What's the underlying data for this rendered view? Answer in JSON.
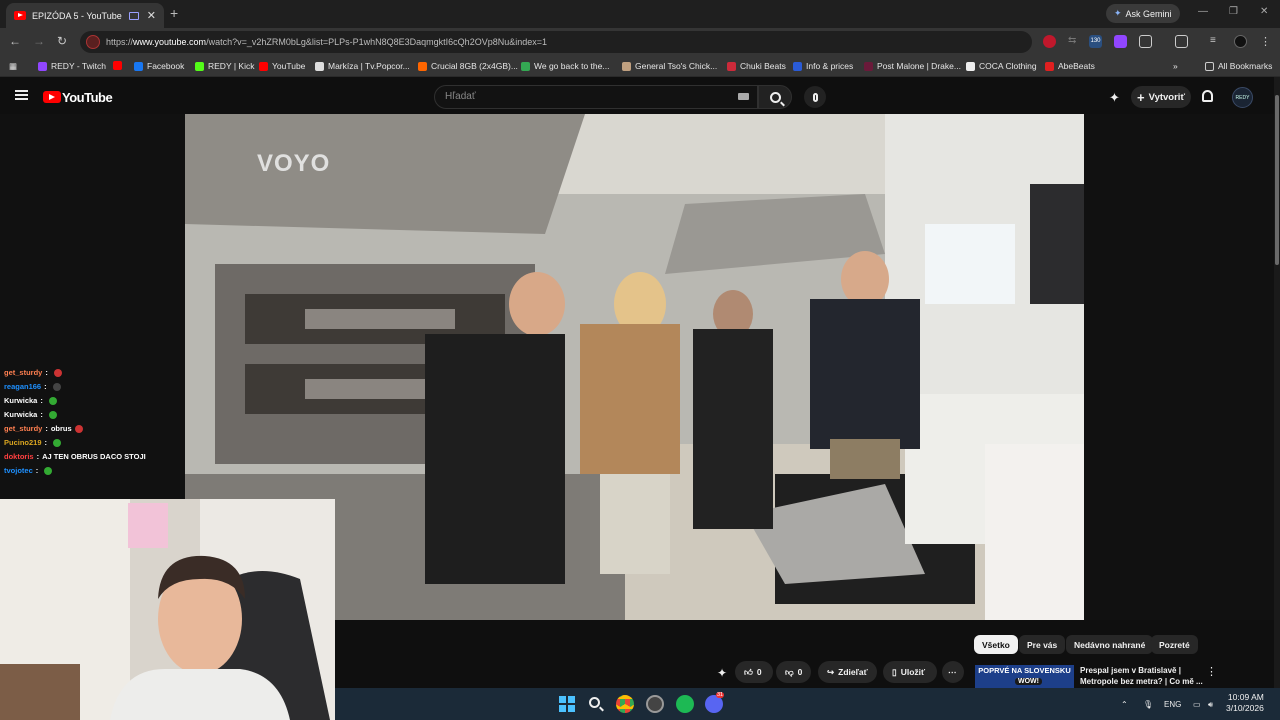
{
  "browser": {
    "tab_title": "EPIZÓDA 5 - YouTube",
    "tab_close": "✕",
    "new_tab": "+",
    "gemini_label": "Ask Gemini",
    "url_prefix": "https://",
    "url_host": "www.youtube.com",
    "url_path": "/watch?v=_v2hZRM0bLg&list=PLPs-P1whN8Q8E3DaqmgktI6cQh2OVp8Nu&index=1",
    "ext_badge": "130",
    "win_minimize": "—",
    "win_restore": "❐",
    "win_close": "✕",
    "bookmarks": [
      {
        "label": "REDY - Twitch",
        "color": "#9146ff"
      },
      {
        "label": "",
        "color": "#ff0000"
      },
      {
        "label": "Facebook",
        "color": "#1877f2"
      },
      {
        "label": "REDY | Kick",
        "color": "#53fc18"
      },
      {
        "label": "YouTube",
        "color": "#ff0000"
      },
      {
        "label": "Markíza | Tv.Popcor...",
        "color": "#dddddd"
      },
      {
        "label": "Crucial 8GB (2x4GB)...",
        "color": "#ff6600"
      },
      {
        "label": "We go back to the...",
        "color": "#34a853"
      },
      {
        "label": "General Tso's Chick...",
        "color": "#c0a080"
      },
      {
        "label": "Chuki Beats",
        "color": "#cc2a3a"
      },
      {
        "label": "Info & prices",
        "color": "#2a5bd7"
      },
      {
        "label": "Post Malone | Drake...",
        "color": "#6a1a3a"
      },
      {
        "label": "COCA Clothing",
        "color": "#eeeeee"
      },
      {
        "label": "AbeBeats",
        "color": "#e02020"
      }
    ],
    "bookmarks_overflow": "»",
    "all_bookmarks": "All Bookmarks"
  },
  "youtube": {
    "logo_text": "YouTube",
    "search_placeholder": "Hľadať",
    "create_label": "Vytvoriť",
    "avatar_text": "REDY",
    "video_watermark": "VOYO",
    "chips": [
      "Všetko",
      "Pre vás",
      "Nedávno nahrané",
      "Pozreté"
    ],
    "actions": {
      "likes": "0",
      "dislikes": "0",
      "share": "Zdieľať",
      "save": "Uložiť",
      "more": "⋯"
    },
    "recommendation": {
      "title": "Prespal jsem v Bratislavě | Metropole bez metra? | Co mě ...",
      "thumb_text_top": "POPRVÉ NA SLOVENSKU",
      "thumb_text_bottom": "WOW!"
    }
  },
  "chat": [
    {
      "user": "get_sturdy",
      "msg": "",
      "color": "#ff7f50",
      "emote": "#c33"
    },
    {
      "user": "reagan166",
      "msg": "",
      "color": "#1e90ff",
      "emote": "#444"
    },
    {
      "user": "Kurwicka",
      "msg": "",
      "color": "#ffffff",
      "emote": "#3a3"
    },
    {
      "user": "Kurwicka",
      "msg": "",
      "color": "#ffffff",
      "emote": "#3a3"
    },
    {
      "user": "get_sturdy",
      "msg": "obrus",
      "color": "#ff7f50",
      "emote": "#c33"
    },
    {
      "user": "Pucino219",
      "msg": "",
      "color": "#daa520",
      "emote": "#3a3"
    },
    {
      "user": "doktoris",
      "msg": "AJ TEN OBRUS DACO STOJI",
      "color": "#ff4040",
      "emote": ""
    },
    {
      "user": "tvojotec",
      "msg": "",
      "color": "#1e90ff",
      "emote": "#3a3"
    }
  ],
  "taskbar": {
    "language": "ENG",
    "time": "10:09 AM",
    "date": "3/10/2026",
    "discord_badge": "31"
  }
}
